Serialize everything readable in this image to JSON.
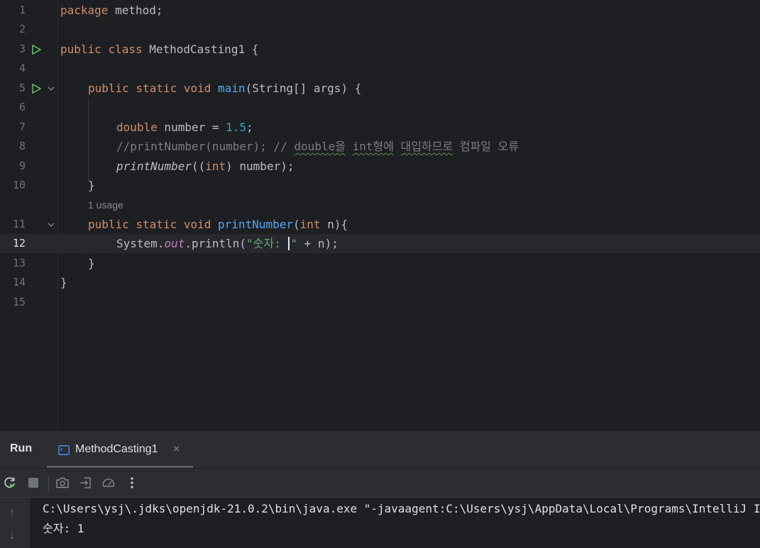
{
  "editor": {
    "lines": {
      "l1": {
        "num": "1",
        "kw": "package",
        "rest": " method;"
      },
      "l2": {
        "num": "2"
      },
      "l3": {
        "num": "3",
        "kw1": "public",
        "kw2": "class",
        "name": "MethodCasting1",
        "brace": " {"
      },
      "l4": {
        "num": "4"
      },
      "l5": {
        "num": "5",
        "kw1": "public",
        "kw2": "static",
        "kw3": "void",
        "name": "main",
        "rest": "(String[] args) {"
      },
      "l6": {
        "num": "6"
      },
      "l7": {
        "num": "7",
        "kw": "double",
        "mid": " number = ",
        "value": "1.5",
        "end": ";"
      },
      "l8": {
        "num": "8",
        "c1": "//printNumber(number); // ",
        "w1": "double을",
        "s1": " ",
        "w2": "int형에",
        "s2": " ",
        "w3": "대입하므로",
        "c2": " 컴파일 오류"
      },
      "l9": {
        "num": "9",
        "call": "printNumber",
        "p1": "((",
        "kw": "int",
        "p2": ") number);"
      },
      "l10": {
        "num": "10",
        "text": "}"
      },
      "l11": {
        "num": "11",
        "kw1": "public",
        "kw2": "static",
        "kw3": "void",
        "name": "printNumber",
        "open": "(",
        "kw4": "int",
        "rest": " n){"
      },
      "l12": {
        "num": "12",
        "obj": "System.",
        "field": "out",
        "call": ".println(",
        "str1": "\"숫자: ",
        "str2": "\"",
        "rest": " + n);"
      },
      "l13": {
        "num": "13",
        "text": "}"
      },
      "l14": {
        "num": "14",
        "text": "}"
      },
      "l15": {
        "num": "15"
      }
    },
    "usage_hint": "1 usage"
  },
  "run_panel": {
    "title": "Run",
    "tab_label": "MethodCasting1",
    "tab_close": "×",
    "console": {
      "line1": "C:\\Users\\ysj\\.jdks\\openjdk-21.0.2\\bin\\java.exe \"-javaagent:C:\\Users\\ysj\\AppData\\Local\\Programs\\IntelliJ IDEA",
      "line2": "숫자: 1"
    },
    "scroll_up": "↑",
    "scroll_down": "↓"
  },
  "icons": {
    "run_gutter": "run-icon",
    "fold": "chevron-down-icon",
    "tab": "console-icon",
    "rerun": "rerun-icon",
    "stop": "stop-icon",
    "screenshot": "camera-icon",
    "exit": "exit-icon",
    "coverage": "gauge-icon",
    "more": "more-vertical-icon"
  },
  "colors": {
    "background": "#1e1f22",
    "keyword": "#cf8e6d",
    "function": "#56a8f5",
    "number": "#2aacb8",
    "string": "#6aab73",
    "comment": "#7a7e85",
    "field": "#c77dbb",
    "run_green": "#5fb865"
  }
}
